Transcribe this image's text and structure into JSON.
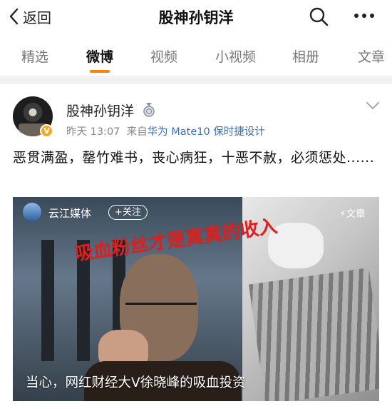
{
  "nav": {
    "back_label": "返回",
    "title": "股神孙钥洋"
  },
  "tabs": [
    "精选",
    "微博",
    "视频",
    "小视频",
    "相册",
    "文章"
  ],
  "active_tab": "微博",
  "colors": {
    "accent": "#ff8200",
    "link": "#3b6fb0",
    "verified": "#f5a623",
    "overlay_red": "#e02020"
  },
  "post": {
    "author": "股神孙钥洋",
    "verified_badge": "V",
    "time": "昨天 13:07",
    "source_prefix": "来自",
    "device": "华为 Mate10 保时捷设计",
    "text": "恶贯满盈，罄竹难书，丧心病狂，十恶不赦，必须惩处......"
  },
  "video": {
    "source_name": "云江媒体",
    "follow_label": "+关注",
    "article_label": "文章",
    "overlay_text": "吸血粉丝才是真真的收入",
    "caption": "当心，网红财经大V徐晓峰的吸血投资"
  },
  "icons": [
    "chevron-left-icon",
    "search-icon",
    "more-icon",
    "medal-icon",
    "chevron-down-icon",
    "lightning-icon"
  ]
}
